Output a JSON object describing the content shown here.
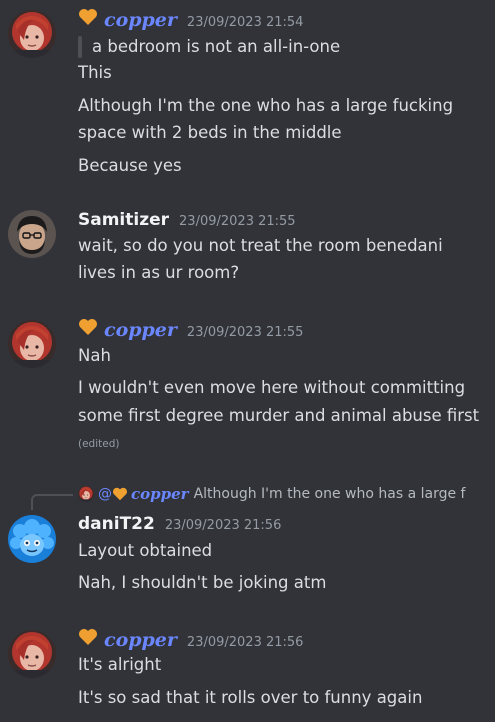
{
  "messages": [
    {
      "author": "copper",
      "timestamp": "23/09/2023 21:54",
      "quote": "a bedroom is not an all-in-one",
      "lines": [
        "This",
        "Although I'm the one who has a large fucking",
        "space with 2 beds in the middle",
        "Because yes"
      ]
    },
    {
      "author": "Samitizer",
      "timestamp": "23/09/2023 21:55",
      "lines": [
        "wait, so do you not treat the room benedani",
        "lives in as ur room?"
      ]
    },
    {
      "author": "copper",
      "timestamp": "23/09/2023 21:55",
      "lines": [
        "Nah",
        "I wouldn't even move here without committing",
        "some first degree murder and animal abuse first"
      ],
      "edited": "(edited)"
    },
    {
      "reply_to": {
        "at": "@",
        "author": "copper",
        "preview": "Although I'm the one who has a large f"
      },
      "author": "daniT22",
      "timestamp": "23/09/2023 21:56",
      "lines": [
        "Layout obtained",
        "Nah, I shouldn't be joking atm"
      ]
    },
    {
      "author": "copper",
      "timestamp": "23/09/2023 21:56",
      "lines": [
        "It's alright",
        "It's so sad that it rolls over to funny again"
      ]
    }
  ],
  "colors": {
    "background": "#313338",
    "copper_name": "#6b87ff",
    "heart": "#f0a030",
    "timestamp": "#949ba4"
  },
  "icons": [
    "heart-icon",
    "avatar-copper",
    "avatar-samitizer",
    "avatar-danit22"
  ]
}
